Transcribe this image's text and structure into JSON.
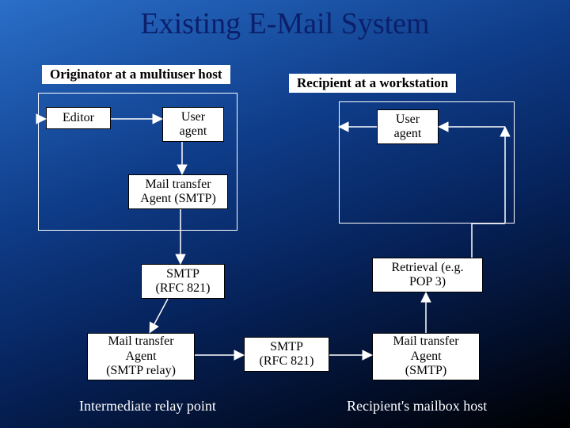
{
  "title": "Existing E-Mail System",
  "labels": {
    "originator": "Originator at a multiuser host",
    "recipient": "Recipient at a workstation",
    "intermediate": "Intermediate relay point",
    "mailbox_host": "Recipient's mailbox host"
  },
  "boxes": {
    "editor": "Editor",
    "user_agent_left": "User\nagent",
    "user_agent_right": "User\nagent",
    "mta_top": "Mail transfer\nAgent (SMTP)",
    "smtp_left": "SMTP\n(RFC 821)",
    "retrieval": "Retrieval (e.g.\nPOP 3)",
    "mta_relay": "Mail transfer\nAgent\n(SMTP relay)",
    "smtp_mid": "SMTP\n(RFC 821)",
    "mta_right": "Mail transfer\nAgent\n(SMTP)"
  }
}
